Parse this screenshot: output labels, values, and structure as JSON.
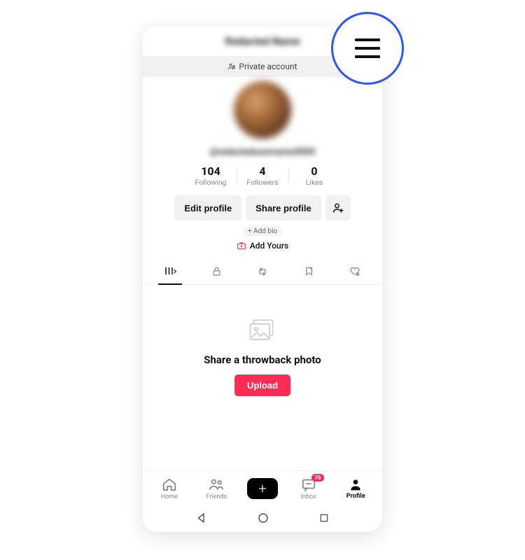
{
  "colors": {
    "accent": "#fe2c55",
    "highlight": "#2b56ff"
  },
  "header": {
    "title": "Redacted Name",
    "private_label": "Private account"
  },
  "profile": {
    "handle": "@redactedusername0000",
    "stats": [
      {
        "count": "104",
        "label": "Following"
      },
      {
        "count": "4",
        "label": "Followers"
      },
      {
        "count": "0",
        "label": "Likes"
      }
    ],
    "edit_label": "Edit profile",
    "share_label": "Share profile",
    "add_bio_label": "+ Add bio",
    "add_yours_label": "Add Yours"
  },
  "tabs": {
    "items": [
      {
        "name": "grid",
        "active": true
      },
      {
        "name": "lock",
        "active": false
      },
      {
        "name": "repost",
        "active": false
      },
      {
        "name": "bookmark",
        "active": false
      },
      {
        "name": "liked",
        "active": false
      }
    ]
  },
  "empty": {
    "title": "Share a throwback photo",
    "upload_label": "Upload"
  },
  "bottomnav": {
    "home": "Home",
    "friends": "Friends",
    "inbox": "Inbox",
    "inbox_badge": "78",
    "profile": "Profile"
  }
}
